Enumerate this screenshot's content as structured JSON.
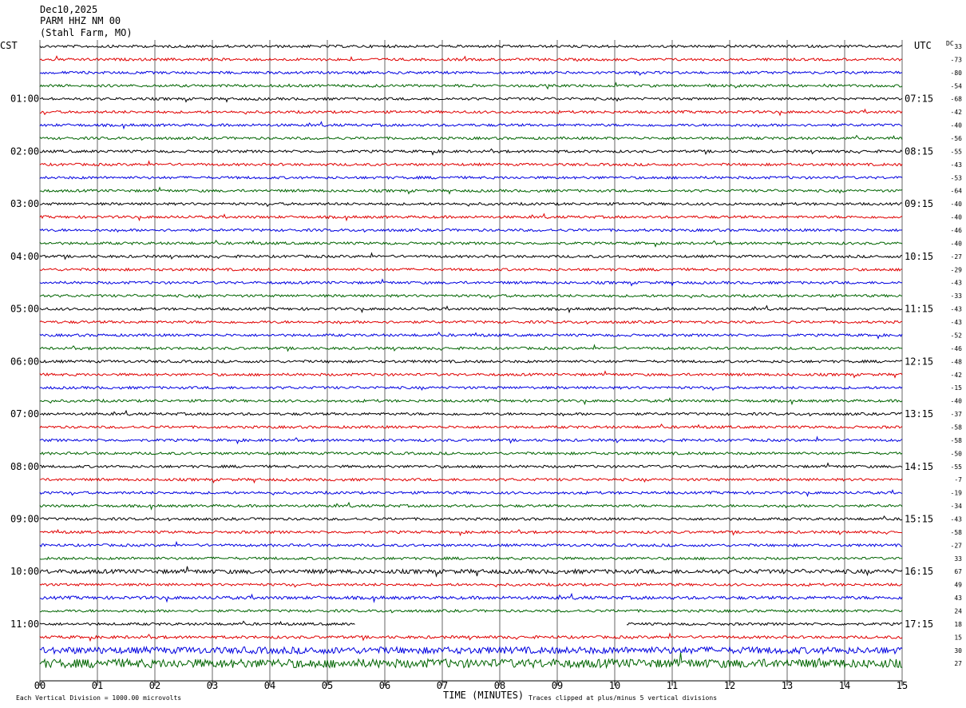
{
  "header": {
    "date": "Dec10,2025",
    "station": "PARM HHZ NM 00",
    "location": "(Stahl Farm, MO)"
  },
  "left_tz": "CST",
  "right_tz": "UTC",
  "dc_label": "DC",
  "footer": {
    "scale_note": "Each Vertical Division = 1000.00 microvolts",
    "xlabel": "TIME (MINUTES)",
    "clip_note": "Traces clipped at plus/minus 5 vertical divisions"
  },
  "chart_data": {
    "type": "line",
    "title": "PARM HHZ NM 00",
    "xlabel": "TIME (MINUTES)",
    "xlim": [
      0,
      15
    ],
    "x_ticks": [
      "00",
      "01",
      "02",
      "03",
      "04",
      "05",
      "06",
      "07",
      "08",
      "09",
      "10",
      "11",
      "12",
      "13",
      "14",
      "15"
    ],
    "left_time_labels": [
      "01:00",
      "02:00",
      "03:00",
      "04:00",
      "05:00",
      "06:00",
      "07:00",
      "08:00",
      "09:00",
      "10:00",
      "11:00"
    ],
    "right_time_labels": [
      "07:15",
      "08:15",
      "09:15",
      "10:15",
      "11:15",
      "12:15",
      "13:15",
      "14:15",
      "15:15",
      "16:15",
      "17:15"
    ],
    "trace_colors": [
      "#000000",
      "#e00000",
      "#0000e0",
      "#006400"
    ],
    "dc_offsets": [
      33,
      -73,
      -80,
      -54,
      -68,
      -42,
      -40,
      -56,
      -55,
      -43,
      -53,
      -64,
      -40,
      -40,
      -46,
      -40,
      -27,
      -29,
      -43,
      -33,
      -43,
      -43,
      -52,
      -46,
      -48,
      -42,
      -15,
      -40,
      -37,
      -58,
      -58,
      -50,
      -55,
      -7,
      -19,
      -34,
      -43,
      -58,
      -27,
      33,
      67,
      49,
      43,
      24,
      18,
      15,
      30,
      27
    ],
    "noise_level": [
      1,
      1,
      1,
      1,
      1,
      1,
      1,
      1,
      1,
      1,
      1,
      1,
      1,
      1,
      1,
      1,
      1,
      1,
      1,
      1,
      1,
      1,
      1,
      1,
      1,
      1,
      1,
      1,
      1,
      1,
      1,
      1,
      1,
      1,
      1,
      1,
      1,
      1,
      1,
      1,
      1.6,
      1,
      1.2,
      1,
      1,
      1.1,
      2.6,
      3.4
    ],
    "gaps": [
      {
        "trace": 44,
        "from_min": 5.5,
        "to_min": 10.2
      }
    ]
  }
}
